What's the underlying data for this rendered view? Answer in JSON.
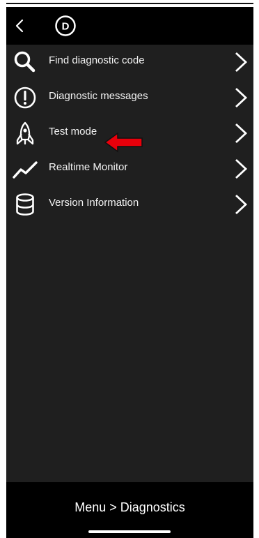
{
  "header": {
    "back_icon": "chevron-left-icon",
    "logo_letter": "D"
  },
  "menu": {
    "items": [
      {
        "label": "Find diagnostic code",
        "icon": "search-icon"
      },
      {
        "label": "Diagnostic messages",
        "icon": "exclamation-circle-icon"
      },
      {
        "label": "Test mode",
        "icon": "rocket-icon"
      },
      {
        "label": "Realtime Monitor",
        "icon": "line-chart-icon"
      },
      {
        "label": "Version Information",
        "icon": "database-icon"
      }
    ],
    "chevron_icon": "chevron-right-icon"
  },
  "annotation": {
    "icon": "red-arrow-left-icon",
    "color": "#e8000b"
  },
  "footer": {
    "breadcrumb": "Menu > Diagnostics"
  },
  "colors": {
    "header_background": "#000000",
    "content_background": "#1f1f1f",
    "text": "#f2f2f2"
  }
}
